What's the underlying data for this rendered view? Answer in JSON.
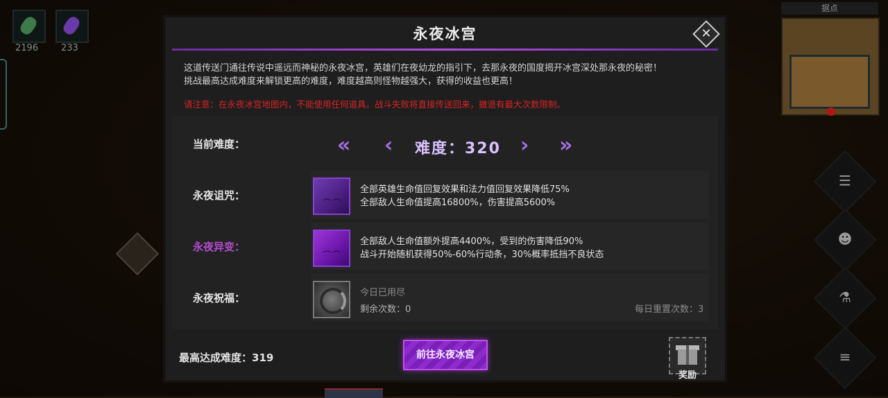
{
  "hud": {
    "left_items": [
      {
        "value": "2196",
        "icon": "leaf-gem-icon",
        "color": "#3f7a4a"
      },
      {
        "value": "233",
        "icon": "purple-gem-icon",
        "color": "#6a3aa8"
      }
    ],
    "map_title": "据点"
  },
  "side_buttons": [
    "document-icon",
    "party-icon",
    "potion-icon",
    "menu-list-icon"
  ],
  "dialog": {
    "title": "永夜冰宫",
    "description_line1": "这道传送门通往传说中遥远而神秘的永夜冰宫，英雄们在夜幼龙的指引下，去那永夜的国度揭开冰宫深处那永夜的秘密！",
    "description_line2": "挑战最高达成难度来解锁更高的难度，难度越高则怪物越强大，获得的收益也更高！",
    "warning": "请注意：在永夜冰宫地图内，不能使用任何道具。战斗失败将直接传送回来，撤退有最大次数限制。",
    "difficulty": {
      "label": "当前难度：",
      "text": "难度：320",
      "value": 320,
      "prev_fast": "«",
      "prev": "‹",
      "next": "›",
      "next_fast": "»"
    },
    "curse": {
      "label": "永夜诅咒：",
      "line1": "全部英雄生命值回复效果和法力值回复效果降低75%",
      "line2": "全部敌人生命值提高16800%，伤害提高5600%"
    },
    "mutation": {
      "label": "永夜异变：",
      "line1": "全部敌人生命值额外提高4400%，受到的伤害降低90%",
      "line2": "战斗开始随机获得50%-60%行动条，30%概率抵挡不良状态"
    },
    "blessing": {
      "label": "永夜祝福：",
      "status": "今日已用尽",
      "remaining": "剩余次数：0",
      "daily_reset": "每日重置次数：3"
    },
    "max_difficulty": "最高达成难度：319",
    "go_button": "前往永夜冰宫",
    "reward_label": "奖励",
    "colors": {
      "accent": "#9b3fd6",
      "warning": "#d92323",
      "mutation_label": "#b54cd0"
    }
  }
}
